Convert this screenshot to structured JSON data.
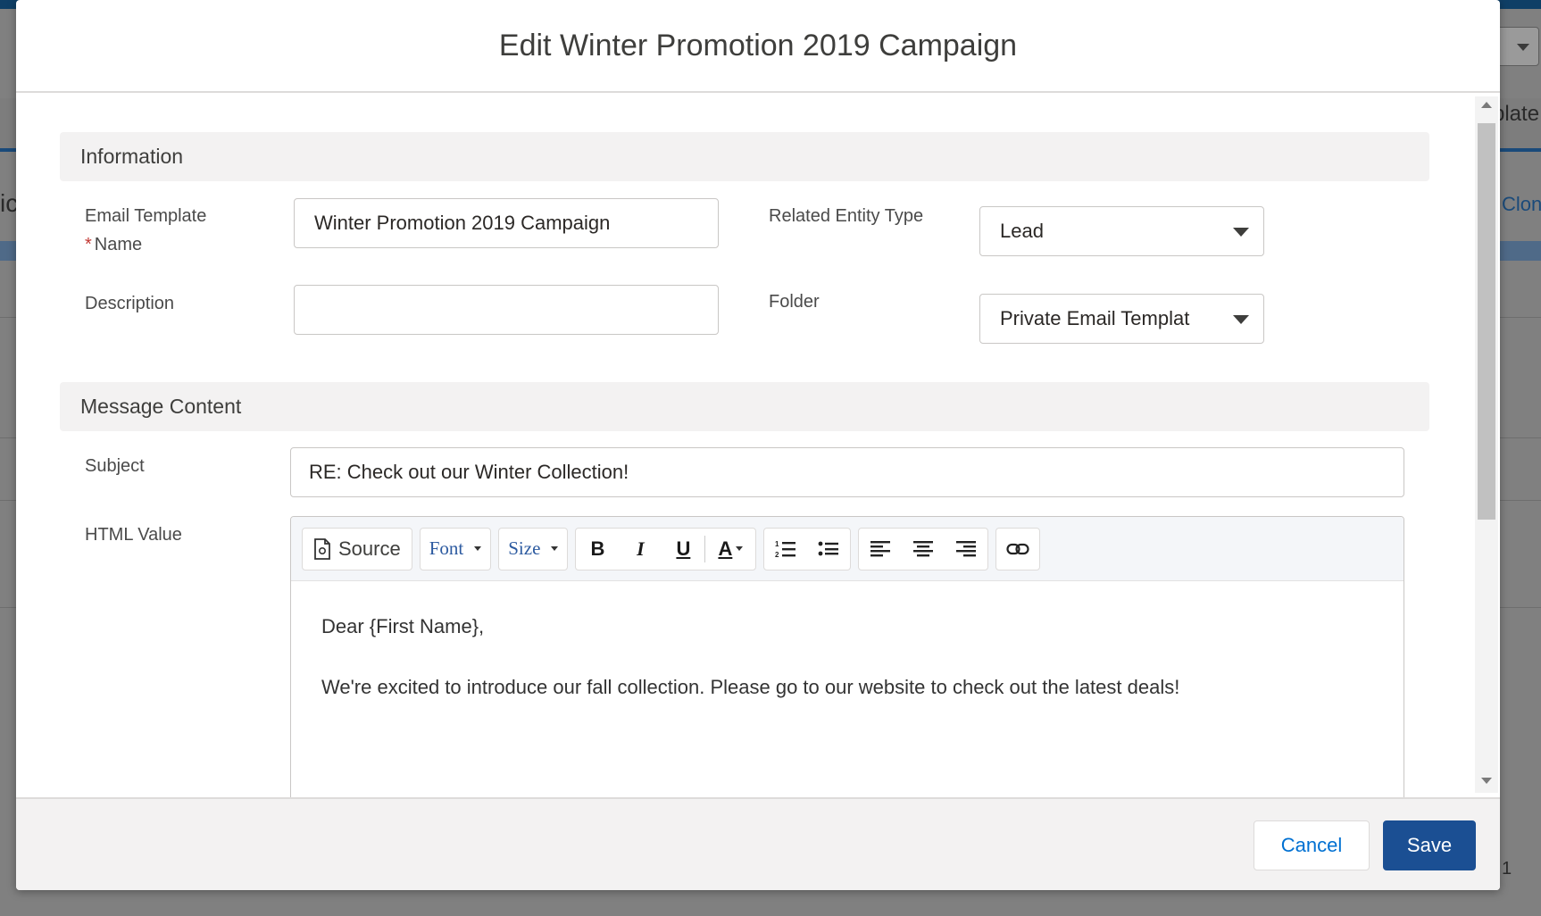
{
  "background": {
    "right_text_1": "plate",
    "right_text_2": "Clon",
    "left_text": "ic",
    "bottom_right_text": "1"
  },
  "modal": {
    "title": "Edit Winter Promotion 2019 Campaign"
  },
  "information": {
    "section_title": "Information",
    "email_template_name_label_1": "Email Template",
    "email_template_name_label_2": "Name",
    "required_marker": "*",
    "email_template_name_value": "Winter Promotion 2019 Campaign",
    "description_label": "Description",
    "description_value": "",
    "related_entity_type_label": "Related Entity Type",
    "related_entity_type_value": "Lead",
    "folder_label": "Folder",
    "folder_value": "Private Email Templat"
  },
  "message_content": {
    "section_title": "Message Content",
    "subject_label": "Subject",
    "subject_value": "RE: Check out our Winter Collection!",
    "html_value_label": "HTML Value",
    "toolbar": {
      "source_label": "Source",
      "font_label": "Font",
      "size_label": "Size",
      "bold": "B",
      "italic": "I",
      "underline": "U",
      "text_color": "A"
    },
    "body_line_1": "Dear {First Name},",
    "body_line_2": "We're excited to introduce our fall collection. Please go to our website to check out the latest deals!"
  },
  "footer": {
    "cancel_label": "Cancel",
    "save_label": "Save"
  },
  "colors": {
    "save_button": "#1b4f93",
    "link_blue": "#0070d2",
    "required_red": "#c23934"
  }
}
